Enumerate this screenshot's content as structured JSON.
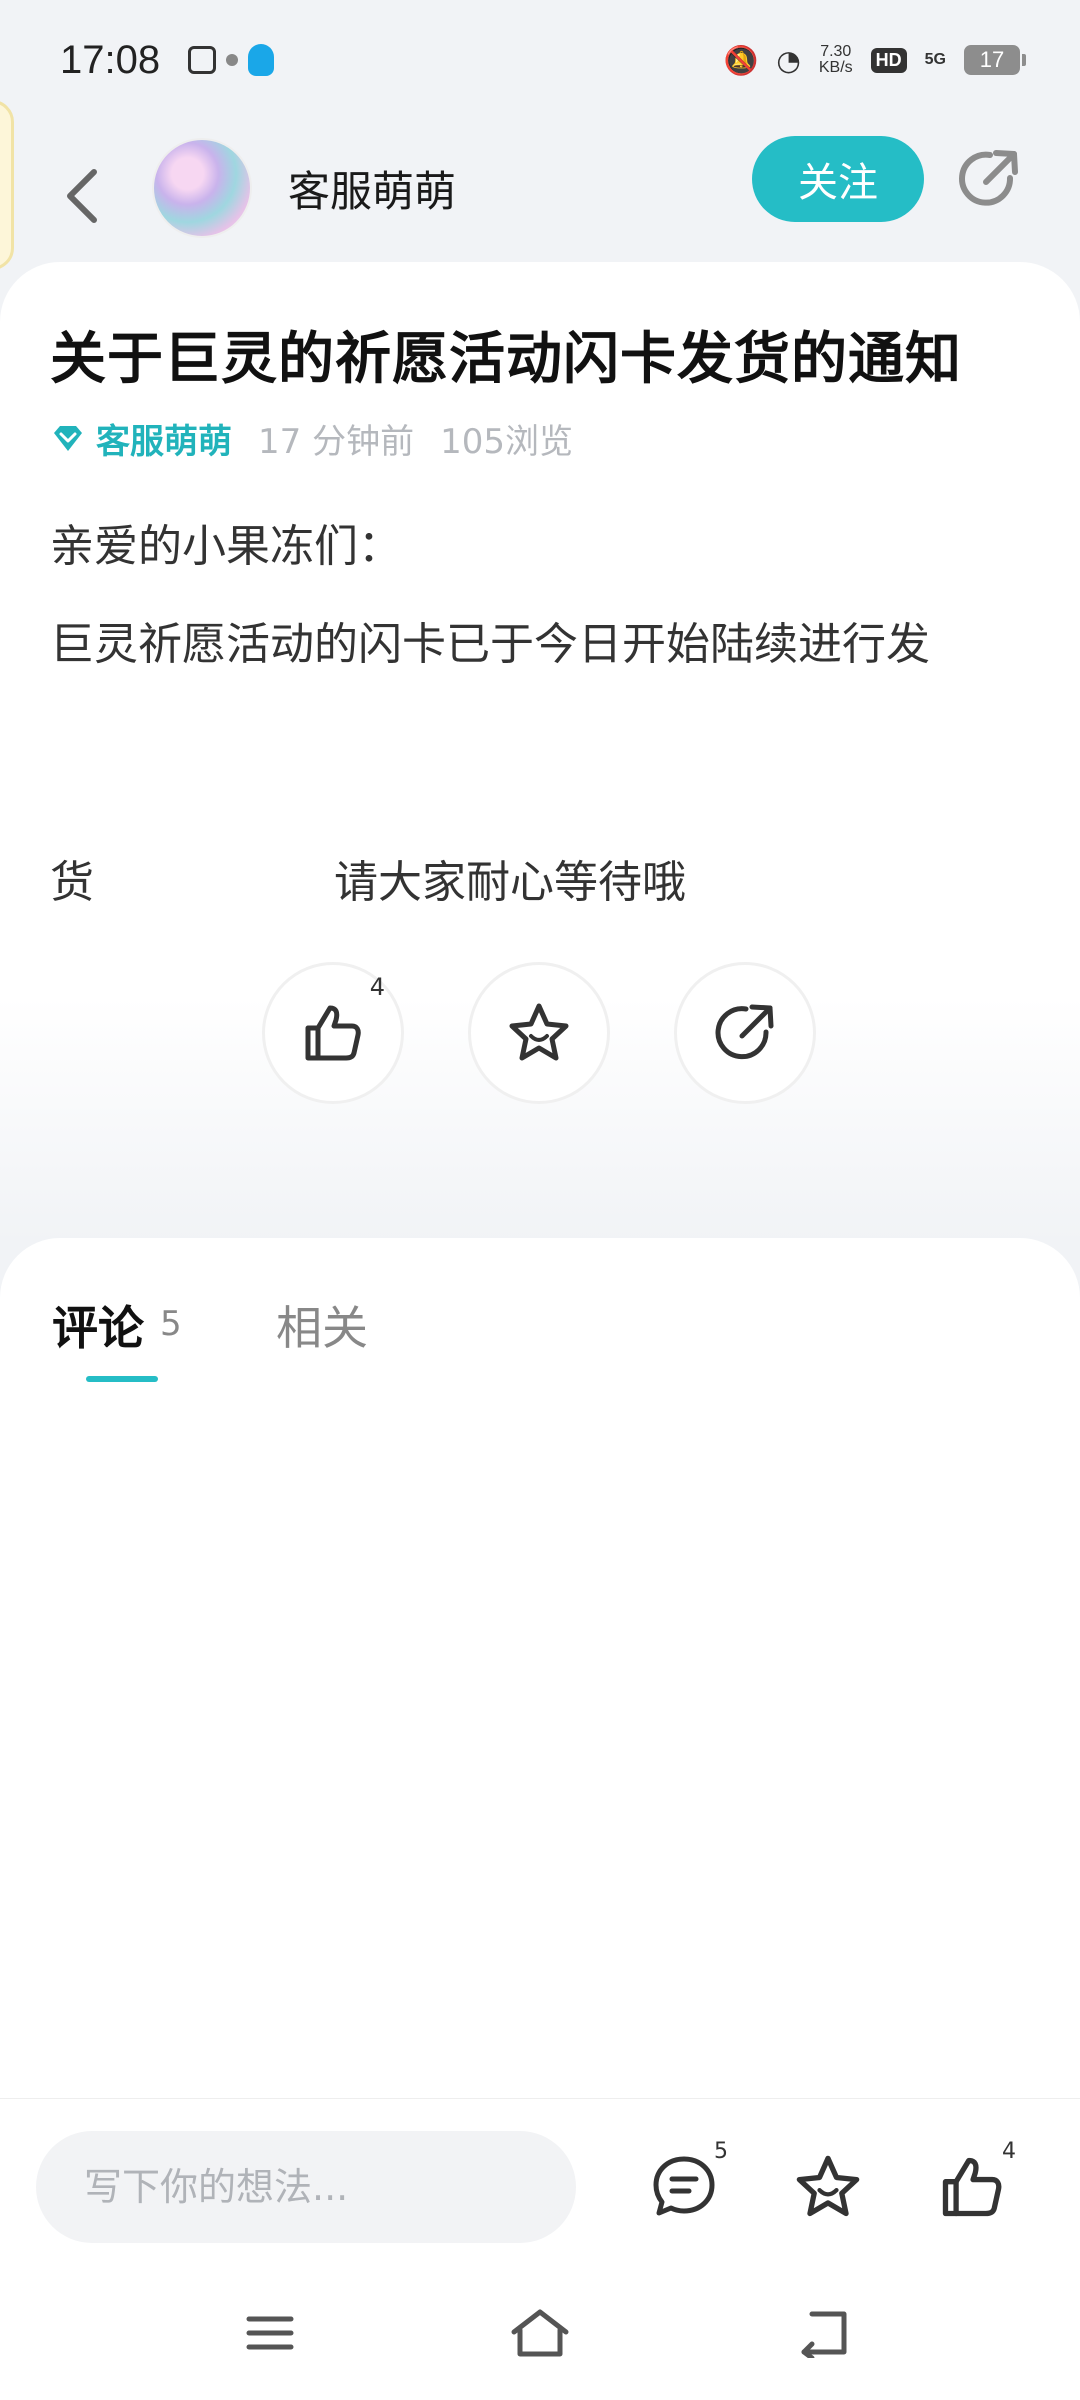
{
  "status_bar": {
    "time": "17:08",
    "net_speed_value": "7.30",
    "net_speed_unit": "KB/s",
    "hd": "HD",
    "signal": "5G",
    "battery": "17"
  },
  "header": {
    "author_name": "客服萌萌",
    "follow_label": "关注"
  },
  "article": {
    "title": "关于巨灵的祈愿活动闪卡发货的通知",
    "meta_author": "客服萌萌",
    "meta_time": "17 分钟前",
    "meta_views": "105浏览",
    "content_line1": "亲爱的小果冻们：",
    "content_line2": "巨灵祈愿活动的闪卡已于今日开始陆续进行发",
    "content_line3a": "货",
    "content_line3b": "请大家耐心等待哦",
    "like_count": "4"
  },
  "comments": {
    "tab_comments_label": "评论",
    "tab_comments_count": "5",
    "tab_related_label": "相关"
  },
  "bottom_bar": {
    "input_placeholder": "写下你的想法...",
    "comment_count": "5",
    "like_count": "4"
  },
  "colors": {
    "accent": "#25bdc6",
    "background": "#f1f3f6"
  },
  "icons": [
    "back-icon",
    "share-icon",
    "like-icon",
    "favorite-icon",
    "comment-icon",
    "diamond-icon",
    "menu-icon",
    "home-icon",
    "return-icon"
  ]
}
